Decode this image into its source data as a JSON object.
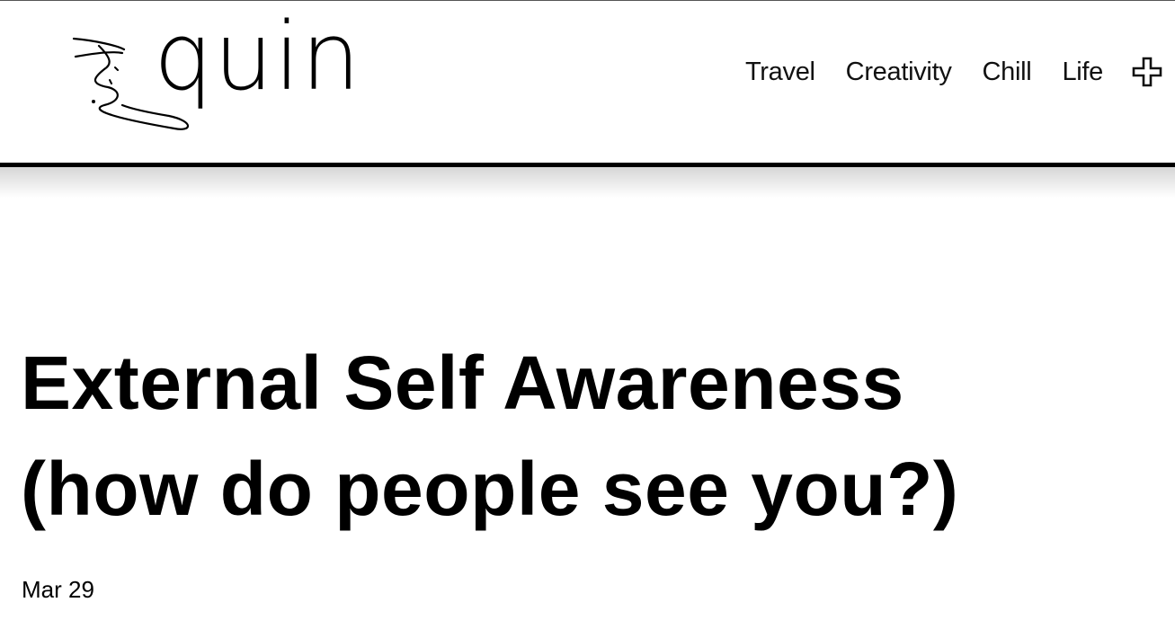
{
  "header": {
    "logo_text": "quin",
    "nav": [
      {
        "label": "Travel"
      },
      {
        "label": "Creativity"
      },
      {
        "label": "Chill"
      },
      {
        "label": "Life"
      }
    ],
    "more_icon": "plus-icon"
  },
  "post": {
    "title_line1": "External Self Awareness",
    "title_line2": "(how do people see you?)",
    "date": "Mar 29"
  }
}
